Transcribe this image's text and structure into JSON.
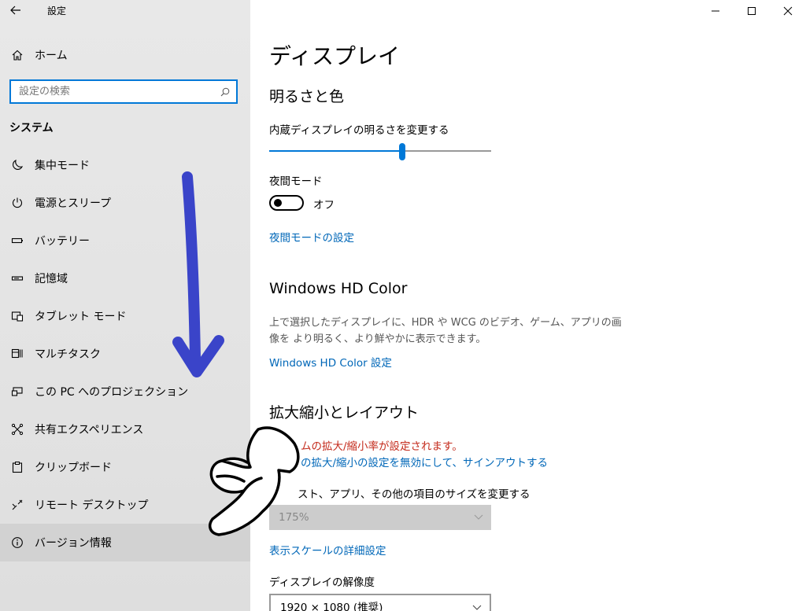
{
  "app": {
    "title": "設定"
  },
  "sidebar": {
    "home_label": "ホーム",
    "search_placeholder": "設定の検索",
    "section_title": "システム",
    "items": [
      {
        "label": "集中モード",
        "icon": "moon-icon"
      },
      {
        "label": "電源とスリープ",
        "icon": "power-icon"
      },
      {
        "label": "バッテリー",
        "icon": "battery-icon"
      },
      {
        "label": "記憶域",
        "icon": "storage-icon"
      },
      {
        "label": "タブレット モード",
        "icon": "tablet-mode-icon"
      },
      {
        "label": "マルチタスク",
        "icon": "multitasking-icon"
      },
      {
        "label": "この PC へのプロジェクション",
        "icon": "projection-icon"
      },
      {
        "label": "共有エクスペリエンス",
        "icon": "shared-experience-icon"
      },
      {
        "label": "クリップボード",
        "icon": "clipboard-icon"
      },
      {
        "label": "リモート デスクトップ",
        "icon": "remote-desktop-icon"
      },
      {
        "label": "バージョン情報",
        "icon": "info-icon"
      }
    ]
  },
  "main": {
    "page_title": "ディスプレイ",
    "brightness": {
      "heading": "明るさと色",
      "slider_label": "内蔵ディスプレイの明るさを変更する",
      "slider_value": 0.6
    },
    "night_mode": {
      "label": "夜間モード",
      "state": "オフ",
      "settings_link": "夜間モードの設定"
    },
    "hdr": {
      "heading": "Windows HD Color",
      "desc": "上で選択したディスプレイに、HDR や WCG のビデオ、ゲーム、アプリの画像を より明るく、より鮮やかに表示できます。",
      "link": "Windows HD Color 設定"
    },
    "scale": {
      "heading": "拡大縮小とレイアウト",
      "warning": "ムの拡大/縮小率が設定されます。",
      "signout_link": "の拡大/縮小の設定を無効にして、サインアウトする",
      "size_label": "スト、アプリ、その他の項目のサイズを変更する",
      "size_value": "175%",
      "advanced_link": "表示スケールの詳細設定",
      "resolution_label": "ディスプレイの解像度",
      "resolution_value": "1920 × 1080 (推奨)"
    }
  },
  "colors": {
    "accent": "#0078d7",
    "link": "#0067b8",
    "warning": "#c42b1c",
    "annotation_arrow": "#3a44c9"
  }
}
